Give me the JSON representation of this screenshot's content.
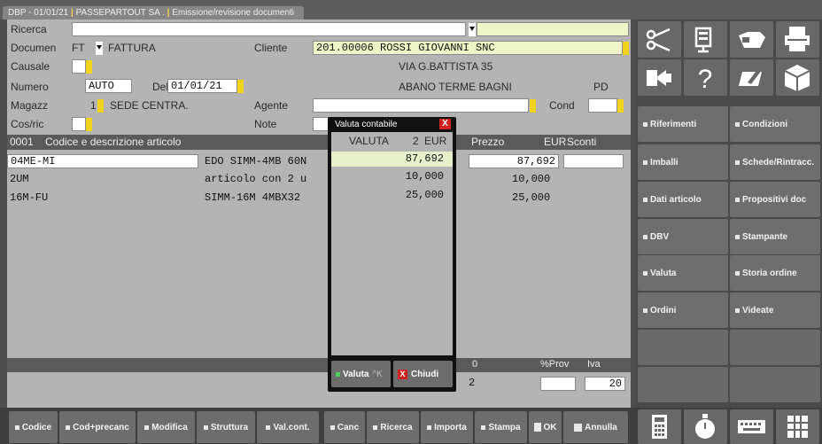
{
  "tab": {
    "part1": "DBP - 01/01/21",
    "part2": "PASSEPARTOUT SA .",
    "part3": "Emissione/revisione documenti"
  },
  "form": {
    "ricerca_label": "Ricerca",
    "ricerca_value": "",
    "documento_label": "Documen",
    "documento_code": "FT",
    "documento_desc": "FATTURA",
    "cliente_label": "Cliente",
    "cliente_value": "201.00006 ROSSI GIOVANNI SNC",
    "causale_label": "Causale",
    "address1": "VIA G.BATTISTA 35",
    "numero_label": "Numero",
    "numero_value": "AUTO",
    "del_label": "Del",
    "del_value": "01/01/21",
    "address2": "ABANO TERME BAGNI",
    "province": "PD",
    "magazz_label": "Magazz",
    "magazz_value": "1",
    "magazz_desc": "SEDE CENTRA.",
    "agente_label": "Agente",
    "cond_label": "Cond",
    "cosric_label": "Cos/ric",
    "note_label": "Note"
  },
  "grid": {
    "headers": {
      "row": "0001",
      "desc": "Codice e descrizione articolo",
      "prezzo": "Prezzo",
      "valuta": "EUR",
      "sconti": "Sconti"
    },
    "rows": [
      {
        "code": "04ME-MI",
        "desc": "EDO SIMM-4MB 60N",
        "prezzo": "87,692"
      },
      {
        "code": "2UM",
        "desc": "articolo con 2 u",
        "prezzo": "10,000"
      },
      {
        "code": "16M-FU",
        "desc": "SIMM-16M 4MBX32",
        "prezzo": "25,000"
      }
    ],
    "footer": {
      "prov": "%Prov",
      "iva": "Iva",
      "iva_value": "20",
      "frag1": "0",
      "frag2": "2"
    }
  },
  "popup": {
    "title": "Valuta contabile",
    "close": "X",
    "col_label": "VALUTA",
    "col_count": "2",
    "col_currency": "EUR",
    "values": [
      "87,692",
      "10,000",
      "25,000"
    ],
    "btn_valuta": "Valuta",
    "btn_valuta_key": "^K",
    "btn_chiudi": "Chiudi",
    "btn_chiudi_icon": "X"
  },
  "right_panel": {
    "buttons": [
      "Riferimenti",
      "Condizioni",
      "Imballi",
      "Schede/Rintracc.",
      "Dati articolo",
      "Propositivi doc",
      "DBV",
      "Stampante",
      "Valuta",
      "Storia ordine",
      "Ordini",
      "Videate"
    ]
  },
  "bottom": {
    "buttons": [
      "Codice",
      "Cod+precanc",
      "Modifica",
      "Struttura",
      "Val.cont.",
      "Canc",
      "Ricerca",
      "Importa",
      "Stampa",
      "OK",
      "Annulla"
    ]
  }
}
